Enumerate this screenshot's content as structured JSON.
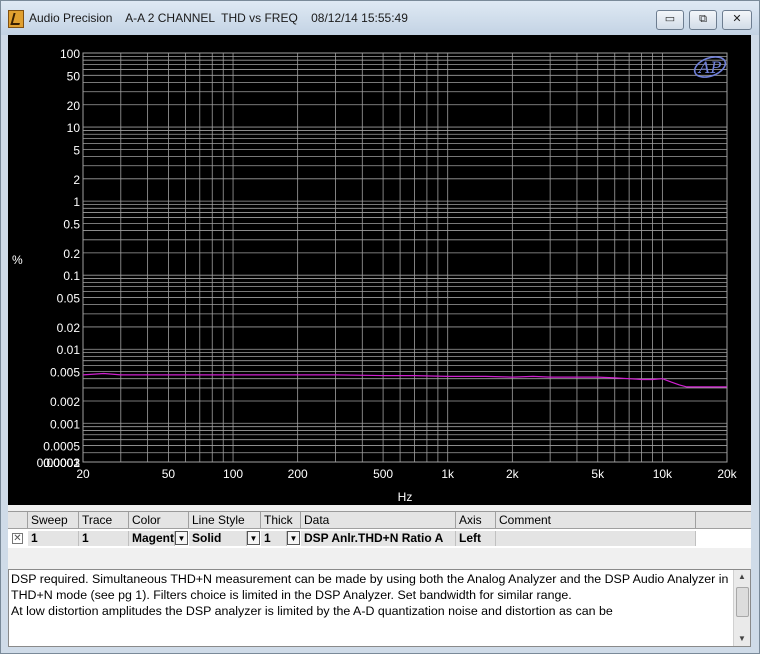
{
  "window": {
    "app_name": "Audio Precision",
    "document_title": "A-A 2 CHANNEL  THD vs FREQ",
    "timestamp": "08/12/14 15:55:49",
    "minimize_symbol": "▭",
    "restore_symbol": "⧉",
    "close_symbol": "✕"
  },
  "colors": {
    "plot_bg": "#000000",
    "grid": "#a0a0a0",
    "trace": "#d020d0",
    "axis_text": "#ffffff",
    "logo": "#6f7fd8"
  },
  "logo_text": "AP",
  "chart_data": {
    "type": "line",
    "xlabel": "Hz",
    "ylabel": "%",
    "x_scale": "log",
    "y_scale": "log",
    "xlim": [
      20,
      20000
    ],
    "ylim": [
      0.0003,
      100
    ],
    "grid": true,
    "x_ticks": [
      20,
      50,
      100,
      200,
      500,
      1000,
      2000,
      5000,
      10000,
      20000
    ],
    "x_tick_labels": [
      "20",
      "50",
      "100",
      "200",
      "500",
      "1k",
      "2k",
      "5k",
      "10k",
      "20k"
    ],
    "y_ticks": [
      100,
      50,
      20,
      10,
      5,
      2,
      1,
      0.5,
      0.2,
      0.1,
      0.05,
      0.02,
      0.01,
      0.005,
      0.002,
      0.001,
      0.0005,
      0.0002,
      0.0001,
      3e-05
    ],
    "y_tick_labels": [
      "100",
      "50",
      "20",
      "10",
      "5",
      "2",
      "1",
      "0.5",
      "0.2",
      "0.1",
      "0.05",
      "0.02",
      "0.01",
      "0.005",
      "0.002",
      "0.001",
      "0.0005",
      "0.0002",
      "0.0001",
      "0.00003"
    ],
    "series": [
      {
        "x": [
          20,
          25,
          30,
          40,
          50,
          70,
          100,
          150,
          200,
          300,
          500,
          700,
          1000,
          1500,
          2000,
          2500,
          3000,
          4000,
          5000,
          6000,
          7000,
          8000,
          9000,
          10000,
          11000,
          12000,
          13000,
          15000,
          20000
        ],
        "y": [
          0.0045,
          0.0047,
          0.0045,
          0.0045,
          0.0045,
          0.0045,
          0.0045,
          0.0045,
          0.0045,
          0.0045,
          0.0044,
          0.0044,
          0.0043,
          0.0043,
          0.0042,
          0.0043,
          0.0042,
          0.0042,
          0.0042,
          0.0041,
          0.004,
          0.0039,
          0.0039,
          0.004,
          0.0036,
          0.0033,
          0.0031,
          0.0031,
          0.0031
        ]
      }
    ]
  },
  "table": {
    "headers": [
      "Sweep",
      "Trace",
      "Color",
      "Line Style",
      "Thick",
      "Data",
      "Axis",
      "Comment"
    ],
    "row": {
      "checkbox": "✕",
      "sweep": "1",
      "trace": "1",
      "color": "Magenta",
      "line_style": "Solid",
      "thick": "1",
      "data": "DSP Anlr.THD+N Ratio A",
      "axis": "Left",
      "comment": ""
    }
  },
  "comment": {
    "line1": "DSP required.  Simultaneous THD+N measurement can be made by using both the Analog Analyzer and the DSP Audio Analyzer in THD+N mode (see pg 1).  Filters choice is limited in the DSP Analyzer.  Set bandwidth for similar range.",
    "line2": "At low distortion amplitudes the DSP analyzer is limited by the A-D quantization noise and distortion as can be"
  }
}
